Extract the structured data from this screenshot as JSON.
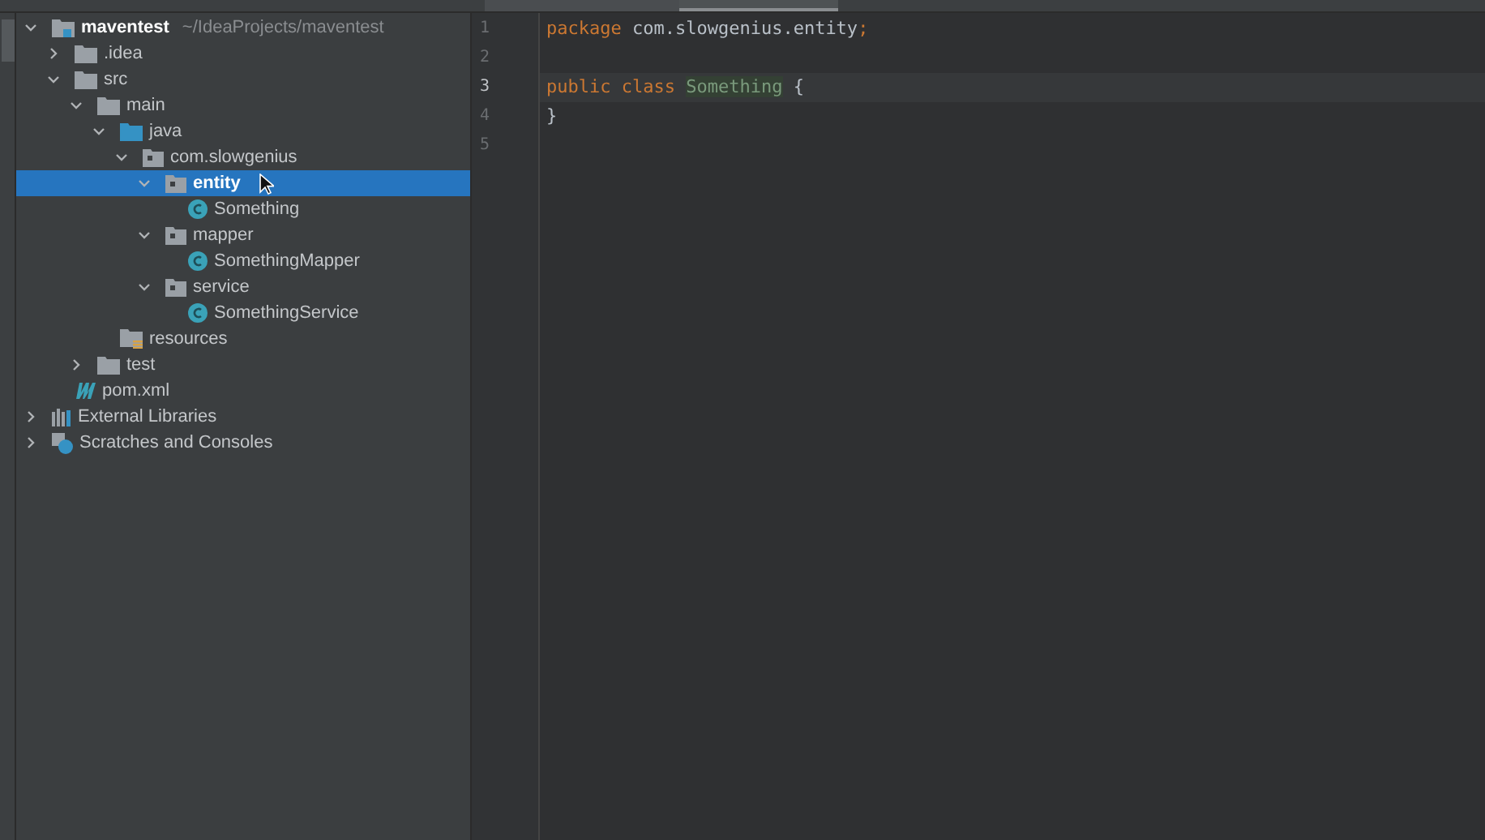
{
  "project_tree": [
    {
      "label": "maventest",
      "path": "~/IdeaProjects/maventest",
      "kind": "module",
      "expanded": true,
      "selected": false,
      "children": [
        {
          "label": ".idea",
          "kind": "folder",
          "expanded": false,
          "selected": false
        },
        {
          "label": "src",
          "kind": "folder",
          "expanded": true,
          "selected": false,
          "children": [
            {
              "label": "main",
              "kind": "folder",
              "expanded": true,
              "selected": false,
              "children": [
                {
                  "label": "java",
                  "kind": "source-folder",
                  "expanded": true,
                  "selected": false,
                  "children": [
                    {
                      "label": "com.slowgenius",
                      "kind": "package",
                      "expanded": true,
                      "selected": false,
                      "children": [
                        {
                          "label": "entity",
                          "kind": "package",
                          "expanded": true,
                          "selected": true,
                          "children": [
                            {
                              "label": "Something",
                              "kind": "class",
                              "selected": false
                            }
                          ]
                        },
                        {
                          "label": "mapper",
                          "kind": "package",
                          "expanded": true,
                          "selected": false,
                          "children": [
                            {
                              "label": "SomethingMapper",
                              "kind": "class",
                              "selected": false
                            }
                          ]
                        },
                        {
                          "label": "service",
                          "kind": "package",
                          "expanded": true,
                          "selected": false,
                          "children": [
                            {
                              "label": "SomethingService",
                              "kind": "class",
                              "selected": false
                            }
                          ]
                        }
                      ]
                    }
                  ]
                },
                {
                  "label": "resources",
                  "kind": "resources",
                  "selected": false
                }
              ]
            },
            {
              "label": "test",
              "kind": "folder",
              "expanded": false,
              "selected": false
            }
          ]
        },
        {
          "label": "pom.xml",
          "kind": "maven",
          "selected": false
        }
      ]
    },
    {
      "label": "External Libraries",
      "kind": "libraries",
      "expanded": false,
      "selected": false
    },
    {
      "label": "Scratches and Consoles",
      "kind": "scratches",
      "expanded": false,
      "selected": false
    }
  ],
  "editor": {
    "lines": [
      {
        "number": "1",
        "current": false,
        "tokens": [
          {
            "kind": "keyword",
            "text": "package"
          },
          {
            "kind": "plain",
            "text": " com.slowgenius.entity"
          },
          {
            "kind": "keyword",
            "text": ";"
          }
        ]
      },
      {
        "number": "2",
        "current": false
      },
      {
        "number": "3",
        "current": true,
        "tokens": [
          {
            "kind": "keyword",
            "text": "public class "
          },
          {
            "kind": "class-name",
            "text": "Something"
          },
          {
            "kind": "plain",
            "text": " {"
          }
        ]
      },
      {
        "number": "4",
        "current": false,
        "tokens": [
          {
            "kind": "plain",
            "text": "}"
          }
        ]
      },
      {
        "number": "5",
        "current": false
      }
    ]
  }
}
